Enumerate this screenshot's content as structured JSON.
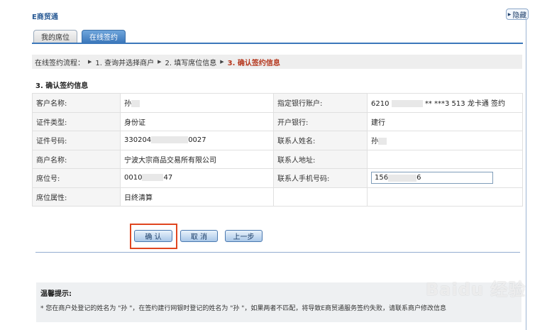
{
  "app": {
    "title": "E商贸通",
    "hide_label": "隐藏"
  },
  "tabs": [
    {
      "label": "我的席位"
    },
    {
      "label": "在线签约"
    }
  ],
  "steps": {
    "prefix": "在线签约流程：",
    "step1": "1. 查询并选择商户",
    "step2": "2. 填写席位信息",
    "step3": "3. 确认签约信息"
  },
  "section": {
    "title": "3. 确认签约信息"
  },
  "fields": {
    "customer_name_label": "客户名称:",
    "customer_name_value": "孙",
    "bank_account_label": "指定银行账户:",
    "bank_account_prefix": "6210",
    "bank_account_suffix": "** ***3 513 龙卡通 签约",
    "id_type_label": "证件类型:",
    "id_type_value": "身份证",
    "open_bank_label": "开户银行:",
    "open_bank_value": "建行",
    "id_number_label": "证件号码:",
    "id_number_prefix": "330204",
    "id_number_suffix": "0027",
    "contact_name_label": "联系人姓名:",
    "contact_name_value": "孙",
    "merchant_name_label": "商户名称:",
    "merchant_name_value": "宁波大宗商品交易所有限公司",
    "contact_address_label": "联系人地址:",
    "contact_address_value": "",
    "seat_no_label": "席位号:",
    "seat_no_prefix": "0010",
    "seat_no_suffix": "47",
    "contact_phone_label": "联系人手机号码:",
    "contact_phone_prefix": "156",
    "contact_phone_suffix": "6",
    "seat_attr_label": "席位属性:",
    "seat_attr_value": "日终清算"
  },
  "buttons": {
    "confirm": "确 认",
    "cancel": "取 消",
    "back": "上一步"
  },
  "tips": {
    "title": "温馨提示:",
    "text": "* 您在商户处登记的姓名为 \"孙     \"，在签约建行网银时登记的姓名为 \"孙     \"，如果两者不匹配，将导致E商贸通服务签约失败，请联系商户修改信息"
  },
  "watermark": "Baidu 经验"
}
